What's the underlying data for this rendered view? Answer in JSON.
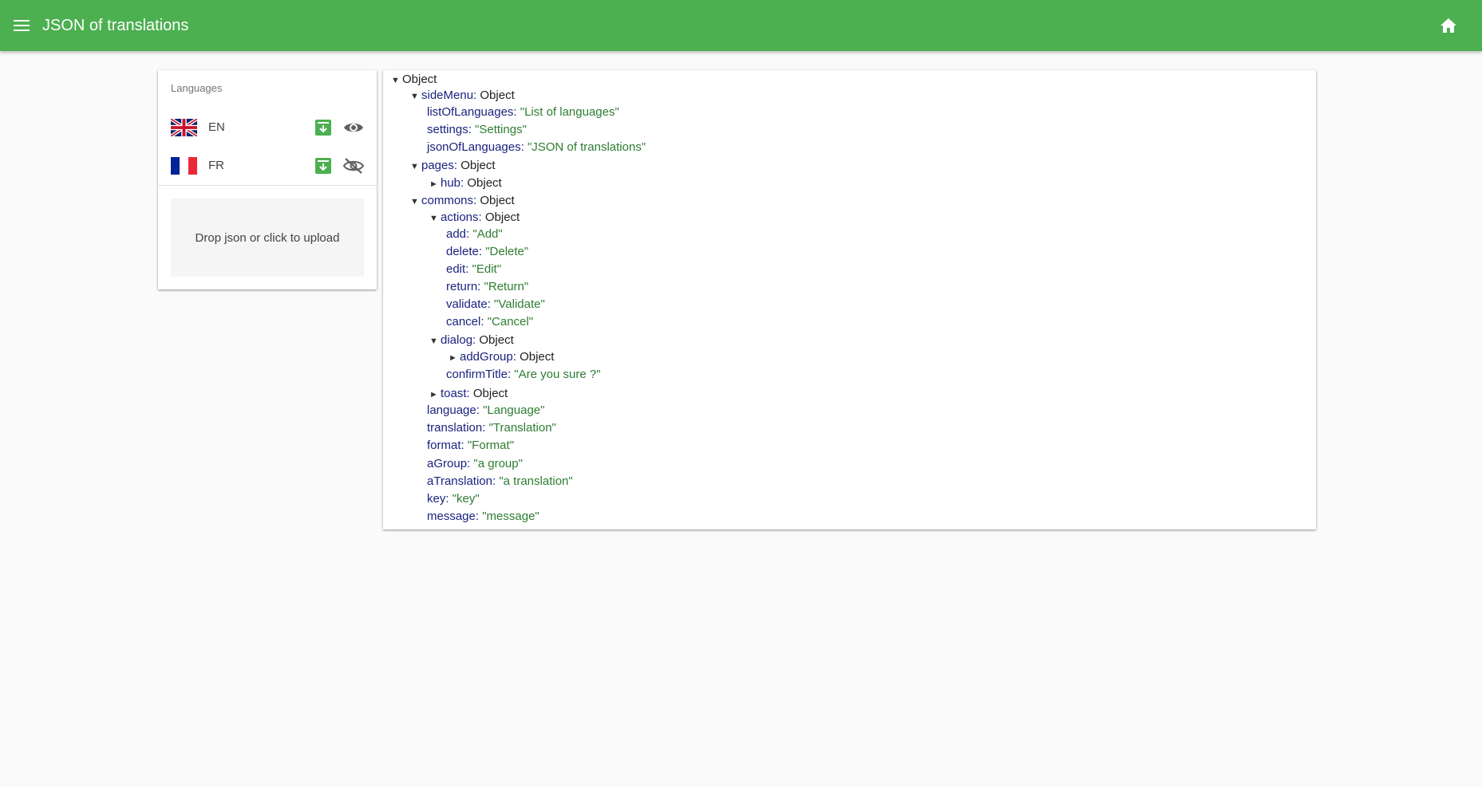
{
  "appbar": {
    "title": "JSON of translations",
    "icons": {
      "menu": "menu-icon",
      "home": "home-icon"
    },
    "color": "#4caf50"
  },
  "languages_panel": {
    "subheader": "Languages",
    "items": [
      {
        "code": "EN",
        "flag": "uk-flag-icon",
        "visible": true,
        "visibility_icon": "eye-icon",
        "download_icon": "download-icon"
      },
      {
        "code": "FR",
        "flag": "france-flag-icon",
        "visible": false,
        "visibility_icon": "eye-off-icon",
        "download_icon": "download-icon"
      }
    ],
    "dropzone_text": "Drop json or click to upload"
  },
  "tree": {
    "root": {
      "label": "Object"
    },
    "sideMenu": {
      "key": "sideMenu",
      "type": "Object"
    },
    "listOfLanguages": {
      "key": "listOfLanguages",
      "value": "\"List of languages\""
    },
    "settings": {
      "key": "settings",
      "value": "\"Settings\""
    },
    "jsonOfLanguages": {
      "key": "jsonOfLanguages",
      "value": "\"JSON of translations\""
    },
    "pages": {
      "key": "pages",
      "type": "Object"
    },
    "hub": {
      "key": "hub",
      "type": "Object"
    },
    "commons": {
      "key": "commons",
      "type": "Object"
    },
    "actions": {
      "key": "actions",
      "type": "Object"
    },
    "add": {
      "key": "add",
      "value": "\"Add\""
    },
    "delete": {
      "key": "delete",
      "value": "\"Delete\""
    },
    "edit": {
      "key": "edit",
      "value": "\"Edit\""
    },
    "return": {
      "key": "return",
      "value": "\"Return\""
    },
    "validate": {
      "key": "validate",
      "value": "\"Validate\""
    },
    "cancel": {
      "key": "cancel",
      "value": "\"Cancel\""
    },
    "dialog": {
      "key": "dialog",
      "type": "Object"
    },
    "addGroup": {
      "key": "addGroup",
      "type": "Object"
    },
    "confirmTitle": {
      "key": "confirmTitle",
      "value": "\"Are you sure ?\""
    },
    "toast": {
      "key": "toast",
      "type": "Object"
    },
    "language": {
      "key": "language",
      "value": "\"Language\""
    },
    "translation": {
      "key": "translation",
      "value": "\"Translation\""
    },
    "format": {
      "key": "format",
      "value": "\"Format\""
    },
    "aGroup": {
      "key": "aGroup",
      "value": "\"a group\""
    },
    "aTranslation": {
      "key": "aTranslation",
      "value": "\"a translation\""
    },
    "key": {
      "key": "key",
      "value": "\"key\""
    },
    "message": {
      "key": "message",
      "value": "\"message\""
    },
    "colors": {
      "key": "#1a237e",
      "string": "#2e7d32"
    }
  }
}
